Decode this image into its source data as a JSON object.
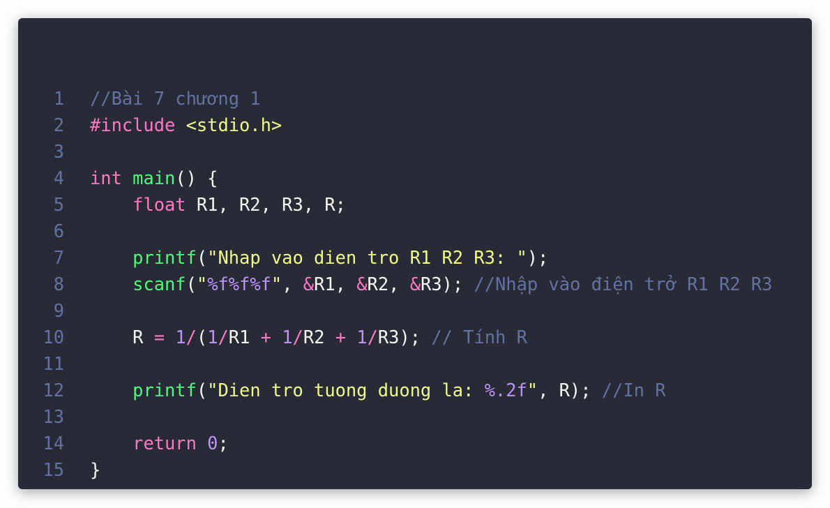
{
  "colors": {
    "background": "#282a36",
    "comment": "#6272a4",
    "keyword": "#ff79c6",
    "function": "#50fa7b",
    "string": "#f1fa8c",
    "number": "#bd93f9",
    "text": "#f8f8f2"
  },
  "code": {
    "lines": [
      {
        "n": "1",
        "tokens": [
          [
            "comment",
            "//Bài 7 chương 1"
          ]
        ]
      },
      {
        "n": "2",
        "tokens": [
          [
            "kw",
            "#include"
          ],
          [
            "plain",
            " "
          ],
          [
            "str",
            "<stdio.h>"
          ]
        ]
      },
      {
        "n": "3",
        "tokens": []
      },
      {
        "n": "4",
        "tokens": [
          [
            "kw",
            "int"
          ],
          [
            "plain",
            " "
          ],
          [
            "fn",
            "main"
          ],
          [
            "plain",
            "() {"
          ]
        ]
      },
      {
        "n": "5",
        "tokens": [
          [
            "plain",
            "    "
          ],
          [
            "kw",
            "float"
          ],
          [
            "plain",
            " R1, R2, R3, R;"
          ]
        ]
      },
      {
        "n": "6",
        "tokens": []
      },
      {
        "n": "7",
        "tokens": [
          [
            "plain",
            "    "
          ],
          [
            "fn",
            "printf"
          ],
          [
            "plain",
            "("
          ],
          [
            "str",
            "\"Nhap vao dien tro R1 R2 R3: \""
          ],
          [
            "plain",
            ");"
          ]
        ]
      },
      {
        "n": "8",
        "tokens": [
          [
            "plain",
            "    "
          ],
          [
            "fn",
            "scanf"
          ],
          [
            "plain",
            "("
          ],
          [
            "str",
            "\""
          ],
          [
            "num",
            "%f%f%f"
          ],
          [
            "str",
            "\""
          ],
          [
            "plain",
            ", "
          ],
          [
            "kw",
            "&"
          ],
          [
            "plain",
            "R1, "
          ],
          [
            "kw",
            "&"
          ],
          [
            "plain",
            "R2, "
          ],
          [
            "kw",
            "&"
          ],
          [
            "plain",
            "R3); "
          ],
          [
            "comment",
            "//Nhập vào điện trở R1 R2 R3"
          ]
        ]
      },
      {
        "n": "9",
        "tokens": []
      },
      {
        "n": "10",
        "tokens": [
          [
            "plain",
            "    R "
          ],
          [
            "kw",
            "="
          ],
          [
            "plain",
            " "
          ],
          [
            "num",
            "1"
          ],
          [
            "kw",
            "/"
          ],
          [
            "plain",
            "("
          ],
          [
            "num",
            "1"
          ],
          [
            "kw",
            "/"
          ],
          [
            "plain",
            "R1 "
          ],
          [
            "kw",
            "+"
          ],
          [
            "plain",
            " "
          ],
          [
            "num",
            "1"
          ],
          [
            "kw",
            "/"
          ],
          [
            "plain",
            "R2 "
          ],
          [
            "kw",
            "+"
          ],
          [
            "plain",
            " "
          ],
          [
            "num",
            "1"
          ],
          [
            "kw",
            "/"
          ],
          [
            "plain",
            "R3); "
          ],
          [
            "comment",
            "// Tính R"
          ]
        ]
      },
      {
        "n": "11",
        "tokens": []
      },
      {
        "n": "12",
        "tokens": [
          [
            "plain",
            "    "
          ],
          [
            "fn",
            "printf"
          ],
          [
            "plain",
            "("
          ],
          [
            "str",
            "\"Dien tro tuong duong la: "
          ],
          [
            "num",
            "%.2f"
          ],
          [
            "str",
            "\""
          ],
          [
            "plain",
            ", R); "
          ],
          [
            "comment",
            "//In R"
          ]
        ]
      },
      {
        "n": "13",
        "tokens": []
      },
      {
        "n": "14",
        "tokens": [
          [
            "plain",
            "    "
          ],
          [
            "kw",
            "return"
          ],
          [
            "plain",
            " "
          ],
          [
            "num",
            "0"
          ],
          [
            "plain",
            ";"
          ]
        ]
      },
      {
        "n": "15",
        "tokens": [
          [
            "plain",
            "}"
          ]
        ]
      }
    ]
  }
}
